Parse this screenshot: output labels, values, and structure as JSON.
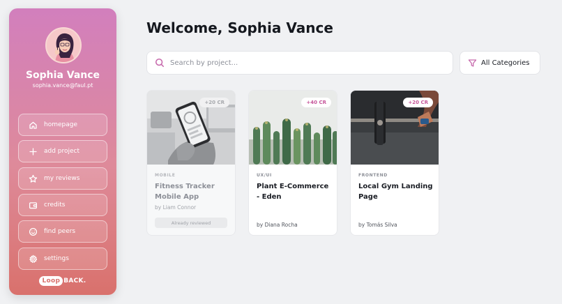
{
  "user": {
    "name": "Sophia Vance",
    "email": "sophia.vance@faul.pt"
  },
  "nav": {
    "items": [
      {
        "label": "homepage",
        "icon": "home-icon"
      },
      {
        "label": "add project",
        "icon": "plus-icon"
      },
      {
        "label": "my reviews",
        "icon": "star-icon"
      },
      {
        "label": "credits",
        "icon": "wallet-icon"
      },
      {
        "label": "find peers",
        "icon": "smile-icon"
      },
      {
        "label": "settings",
        "icon": "gear-icon"
      }
    ]
  },
  "logo": {
    "part1": "Loop",
    "part2": "BACK."
  },
  "main": {
    "welcome": "Welcome, Sophia Vance",
    "search_placeholder": "Search by project...",
    "category_filter": "All Categories"
  },
  "projects": [
    {
      "credits": "+20 CR",
      "category": "MOBILE",
      "title": "Fitness Tracker Mobile App",
      "author": "by Liam Connor",
      "status": "Already reviewed"
    },
    {
      "credits": "+40 CR",
      "category": "UX/UI",
      "title": "Plant E-Commerce - Eden",
      "author": "by Diana Rocha"
    },
    {
      "credits": "+20 CR",
      "category": "FRONTEND",
      "title": "Local Gym Landing Page",
      "author": "by Tomás Silva"
    }
  ],
  "colors": {
    "accent": "#c769ac",
    "sidebar_top": "#d27fbd",
    "sidebar_bottom": "#d9716c"
  }
}
